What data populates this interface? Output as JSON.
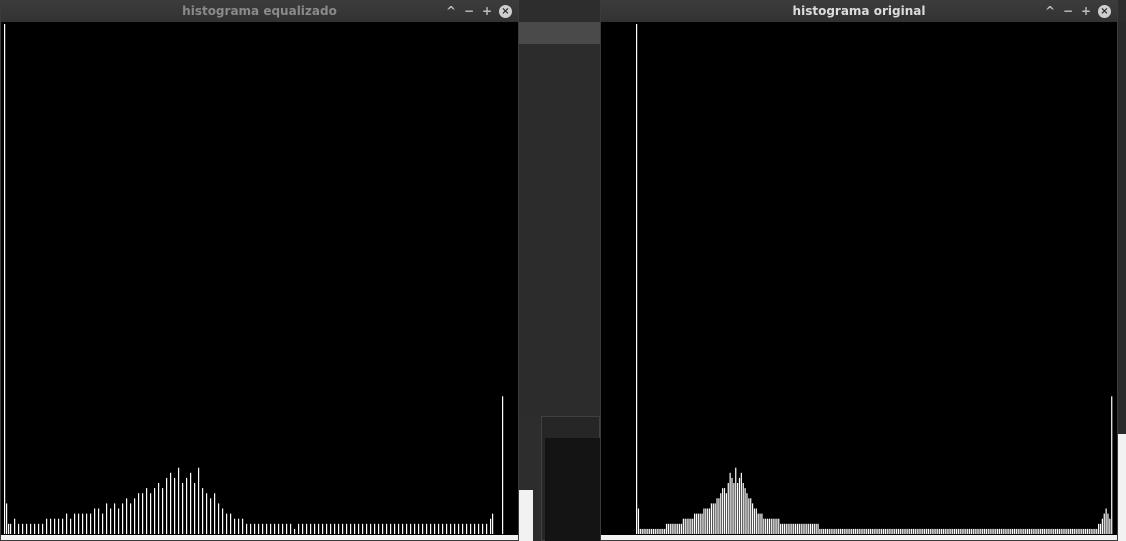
{
  "windows": {
    "left": {
      "title": "histograma equalizado",
      "active": false
    },
    "right": {
      "title": "histograma original",
      "active": true
    }
  },
  "controls": {
    "shade": "^",
    "minimize": "−",
    "maximize": "+",
    "close": "×"
  },
  "colors": {
    "bars": "#ffffff",
    "plot_background": "#000000",
    "titlebar": "#373737"
  },
  "chart_data": [
    {
      "type": "bar",
      "xlim": [
        0,
        255
      ],
      "ylim": [
        0,
        100
      ],
      "grid": false,
      "values": [
        100,
        6,
        2,
        2,
        0,
        3,
        0,
        2,
        0,
        2,
        0,
        2,
        0,
        2,
        0,
        2,
        0,
        2,
        0,
        2,
        0,
        3,
        0,
        3,
        0,
        3,
        0,
        3,
        0,
        3,
        0,
        4,
        0,
        3,
        0,
        4,
        0,
        4,
        0,
        4,
        0,
        4,
        0,
        4,
        0,
        5,
        0,
        5,
        0,
        4,
        0,
        6,
        0,
        5,
        0,
        6,
        0,
        5,
        0,
        6,
        0,
        7,
        0,
        6,
        0,
        7,
        0,
        8,
        0,
        8,
        0,
        9,
        0,
        8,
        0,
        9,
        0,
        10,
        0,
        9,
        0,
        11,
        0,
        12,
        0,
        11,
        0,
        13,
        0,
        10,
        0,
        11,
        0,
        12,
        0,
        10,
        0,
        13,
        0,
        9,
        0,
        8,
        0,
        7,
        0,
        8,
        0,
        6,
        0,
        5,
        0,
        4,
        0,
        4,
        0,
        3,
        0,
        3,
        0,
        3,
        0,
        2,
        0,
        2,
        0,
        2,
        0,
        2,
        0,
        2,
        0,
        2,
        0,
        2,
        0,
        2,
        0,
        2,
        0,
        2,
        0,
        2,
        0,
        2,
        0,
        1,
        0,
        2,
        0,
        2,
        0,
        2,
        0,
        2,
        0,
        2,
        0,
        2,
        0,
        2,
        0,
        2,
        0,
        2,
        0,
        2,
        0,
        2,
        0,
        2,
        0,
        2,
        0,
        2,
        0,
        2,
        0,
        2,
        0,
        2,
        0,
        2,
        0,
        2,
        0,
        2,
        0,
        2,
        0,
        2,
        0,
        2,
        0,
        2,
        0,
        2,
        0,
        2,
        0,
        2,
        0,
        2,
        0,
        2,
        0,
        2,
        0,
        2,
        0,
        2,
        0,
        2,
        0,
        2,
        0,
        2,
        0,
        2,
        0,
        2,
        0,
        2,
        0,
        2,
        0,
        2,
        0,
        2,
        0,
        2,
        0,
        2,
        0,
        2,
        0,
        2,
        0,
        2,
        0,
        2,
        0,
        2,
        0,
        3,
        4,
        0,
        0,
        0,
        0,
        27
      ]
    },
    {
      "type": "bar",
      "xlim": [
        0,
        255
      ],
      "ylim": [
        0,
        100
      ],
      "grid": false,
      "values": [
        100,
        5,
        1,
        1,
        1,
        1,
        1,
        1,
        1,
        1,
        1,
        1,
        1,
        1,
        1,
        1,
        2,
        2,
        2,
        2,
        2,
        2,
        2,
        2,
        2,
        3,
        3,
        3,
        3,
        3,
        3,
        4,
        4,
        4,
        4,
        4,
        5,
        5,
        5,
        5,
        6,
        6,
        6,
        7,
        7,
        8,
        9,
        9,
        8,
        10,
        12,
        11,
        10,
        13,
        10,
        11,
        12,
        10,
        9,
        8,
        7,
        7,
        6,
        5,
        5,
        4,
        4,
        4,
        3,
        3,
        3,
        3,
        3,
        3,
        3,
        3,
        3,
        2,
        2,
        2,
        2,
        2,
        2,
        2,
        2,
        2,
        2,
        2,
        2,
        2,
        2,
        2,
        2,
        2,
        2,
        2,
        2,
        2,
        1,
        1,
        1,
        1,
        1,
        1,
        1,
        1,
        1,
        1,
        1,
        1,
        1,
        1,
        1,
        1,
        1,
        1,
        1,
        1,
        1,
        1,
        1,
        1,
        1,
        1,
        1,
        1,
        1,
        1,
        1,
        1,
        1,
        1,
        1,
        1,
        1,
        1,
        1,
        1,
        1,
        1,
        1,
        1,
        1,
        1,
        1,
        1,
        1,
        1,
        1,
        1,
        1,
        1,
        1,
        1,
        1,
        1,
        1,
        1,
        1,
        1,
        1,
        1,
        1,
        1,
        1,
        1,
        1,
        1,
        1,
        1,
        1,
        1,
        1,
        1,
        1,
        1,
        1,
        1,
        1,
        1,
        1,
        1,
        1,
        1,
        1,
        1,
        1,
        1,
        1,
        1,
        1,
        1,
        1,
        1,
        1,
        1,
        1,
        1,
        1,
        1,
        1,
        1,
        1,
        1,
        1,
        1,
        1,
        1,
        1,
        1,
        1,
        1,
        1,
        1,
        1,
        1,
        1,
        1,
        1,
        1,
        1,
        1,
        1,
        1,
        1,
        1,
        1,
        1,
        1,
        1,
        1,
        1,
        1,
        1,
        1,
        1,
        1,
        1,
        1,
        1,
        1,
        1,
        1,
        1,
        1,
        1,
        1,
        2,
        2,
        3,
        4,
        5,
        4,
        3,
        27,
        0,
        0,
        0,
        0
      ]
    }
  ]
}
